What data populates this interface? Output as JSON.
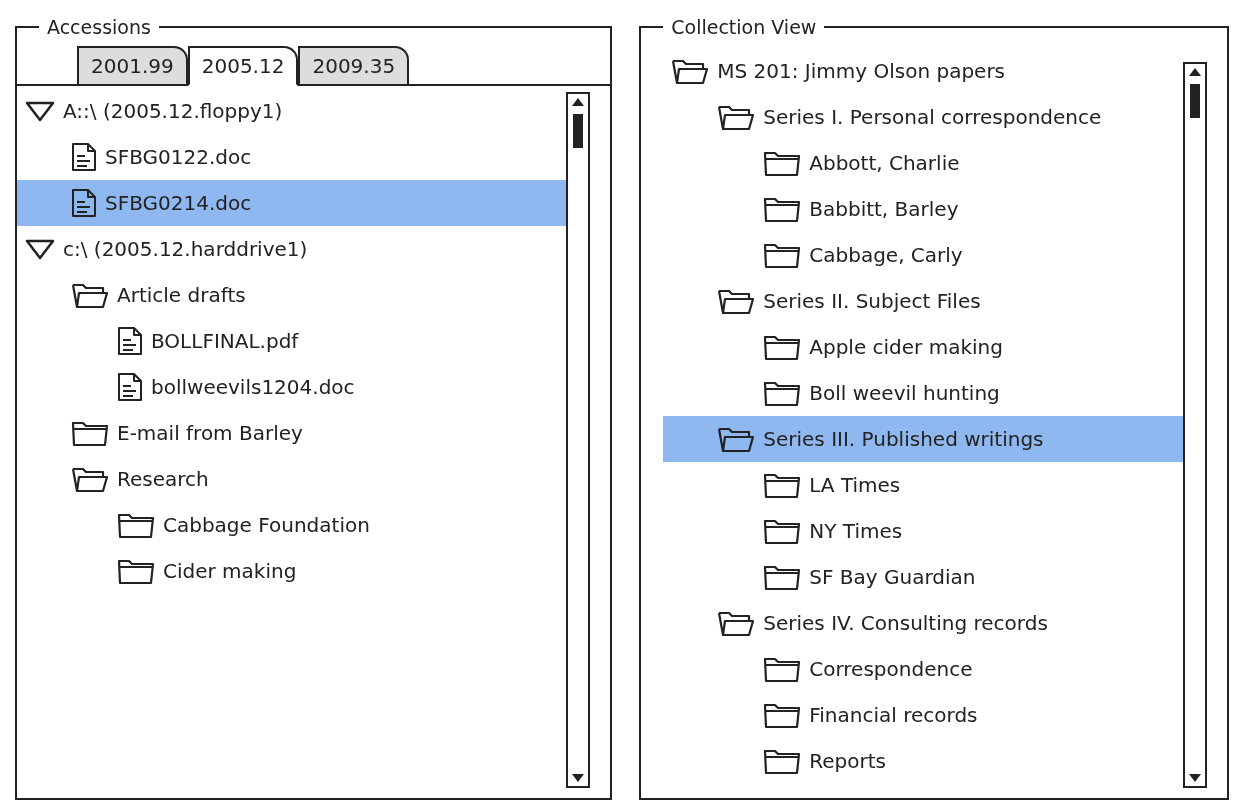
{
  "accessions": {
    "title": "Accessions",
    "tabs": [
      {
        "label": "2001.99",
        "selected": false
      },
      {
        "label": "2005.12",
        "selected": true
      },
      {
        "label": "2009.35",
        "selected": false
      }
    ],
    "tree": [
      {
        "kind": "drive",
        "label": "A::\\ (2005.12.floppy1)",
        "expanded": true,
        "selected": false,
        "children": [
          {
            "kind": "file",
            "label": "SFBG0122.doc",
            "selected": false
          },
          {
            "kind": "file",
            "label": "SFBG0214.doc",
            "selected": true
          }
        ]
      },
      {
        "kind": "drive",
        "label": "c:\\ (2005.12.harddrive1)",
        "expanded": true,
        "selected": false,
        "children": [
          {
            "kind": "folder",
            "label": "Article drafts",
            "expanded": true,
            "selected": false,
            "children": [
              {
                "kind": "file",
                "label": "BOLLFINAL.pdf",
                "selected": false
              },
              {
                "kind": "file",
                "label": "bollweevils1204.doc",
                "selected": false
              }
            ]
          },
          {
            "kind": "folder",
            "label": "E-mail from Barley",
            "expanded": false,
            "selected": false
          },
          {
            "kind": "folder",
            "label": "Research",
            "expanded": true,
            "selected": false,
            "children": [
              {
                "kind": "folder",
                "label": "Cabbage Foundation",
                "expanded": false,
                "selected": false
              },
              {
                "kind": "folder",
                "label": "Cider making",
                "expanded": false,
                "selected": false
              }
            ]
          }
        ]
      }
    ]
  },
  "collection_view": {
    "title": "Collection View",
    "tree": [
      {
        "kind": "folder",
        "label": "MS 201: Jimmy Olson papers",
        "expanded": true,
        "selected": false,
        "children": [
          {
            "kind": "folder",
            "label": "Series I. Personal correspondence",
            "expanded": true,
            "selected": false,
            "children": [
              {
                "kind": "folder",
                "label": "Abbott, Charlie",
                "expanded": false,
                "selected": false
              },
              {
                "kind": "folder",
                "label": "Babbitt, Barley",
                "expanded": false,
                "selected": false
              },
              {
                "kind": "folder",
                "label": "Cabbage, Carly",
                "expanded": false,
                "selected": false
              }
            ]
          },
          {
            "kind": "folder",
            "label": "Series II. Subject Files",
            "expanded": true,
            "selected": false,
            "children": [
              {
                "kind": "folder",
                "label": "Apple cider making",
                "expanded": false,
                "selected": false
              },
              {
                "kind": "folder",
                "label": "Boll weevil hunting",
                "expanded": false,
                "selected": false
              }
            ]
          },
          {
            "kind": "folder",
            "label": "Series III. Published writings",
            "expanded": true,
            "selected": true,
            "children": [
              {
                "kind": "folder",
                "label": "LA Times",
                "expanded": false,
                "selected": false
              },
              {
                "kind": "folder",
                "label": "NY Times",
                "expanded": false,
                "selected": false
              },
              {
                "kind": "folder",
                "label": "SF Bay Guardian",
                "expanded": false,
                "selected": false
              }
            ]
          },
          {
            "kind": "folder",
            "label": "Series IV. Consulting records",
            "expanded": true,
            "selected": false,
            "children": [
              {
                "kind": "folder",
                "label": "Correspondence",
                "expanded": false,
                "selected": false
              },
              {
                "kind": "folder",
                "label": "Financial records",
                "expanded": false,
                "selected": false
              },
              {
                "kind": "folder",
                "label": "Reports",
                "expanded": false,
                "selected": false
              }
            ]
          }
        ]
      }
    ]
  }
}
